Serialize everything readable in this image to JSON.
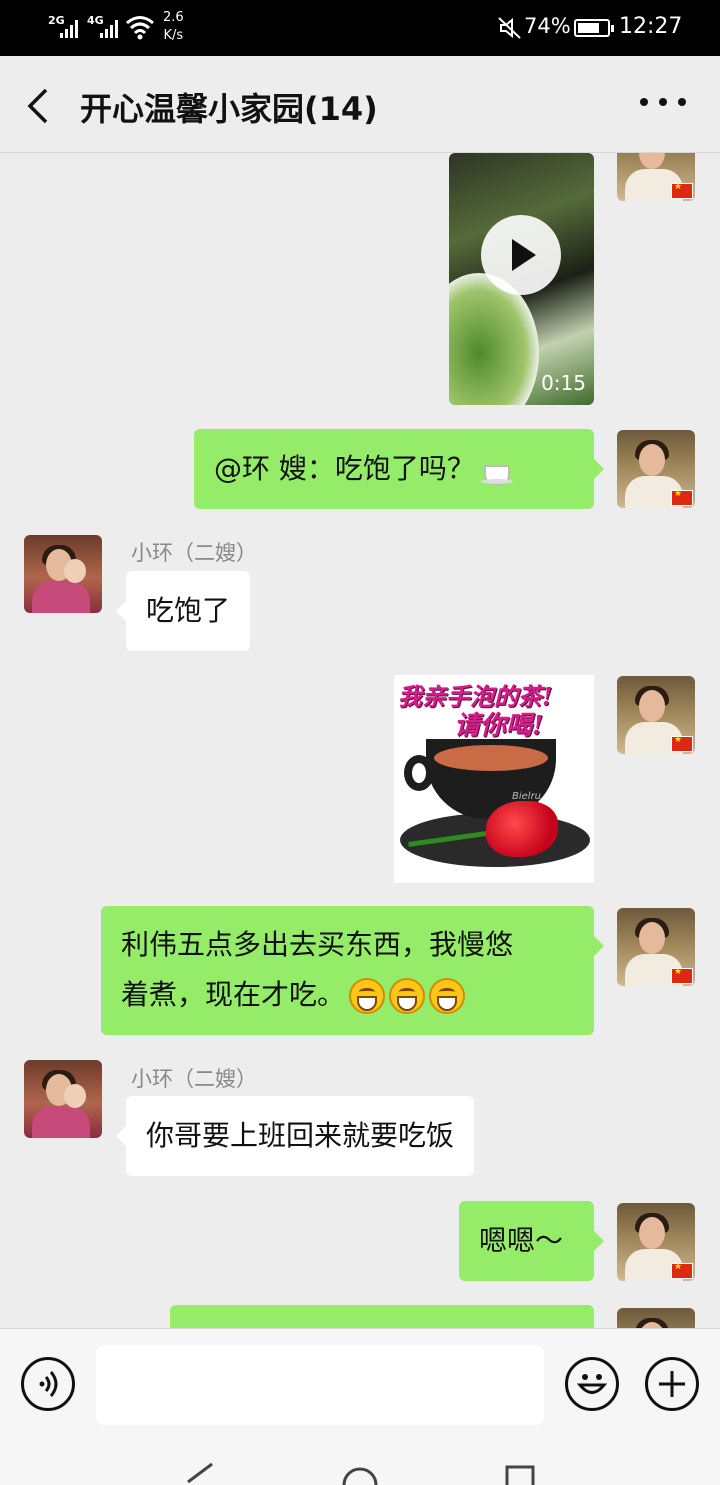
{
  "status_bar": {
    "sim1": "2G",
    "sim2": "4G",
    "speed_value": "2.6",
    "speed_unit": "K/s",
    "battery": "74%",
    "battery_level": 0.74,
    "time": "12:27"
  },
  "header": {
    "title": "开心温馨小家园(14)"
  },
  "messages": [
    {
      "type": "video",
      "from": "me",
      "duration": "0:15"
    },
    {
      "type": "text",
      "from": "me",
      "text": "@环  嫂：吃饱了吗？",
      "emoji": "tea-icon"
    },
    {
      "type": "text",
      "from": "other",
      "sender": "小环（二嫂）",
      "text": "吃饱了"
    },
    {
      "type": "image",
      "from": "me",
      "image_text_line1": "我亲手泡的茶!",
      "image_text_line2": "请你喝!",
      "image_brand": "Bielru"
    },
    {
      "type": "text",
      "from": "me",
      "text_line1": "利伟五点多出去买东西，我慢悠",
      "text_line2": "着煮，现在才吃。",
      "emoji": "grinning-face-icon"
    },
    {
      "type": "text",
      "from": "other",
      "sender": "小环（二嫂）",
      "text": "你哥要上班回来就要吃饭"
    },
    {
      "type": "text",
      "from": "me",
      "text": "嗯嗯～"
    }
  ],
  "input": {
    "placeholder": ""
  },
  "colors": {
    "my_bubble": "#95ec69",
    "their_bubble": "#ffffff",
    "background": "#ededed"
  }
}
